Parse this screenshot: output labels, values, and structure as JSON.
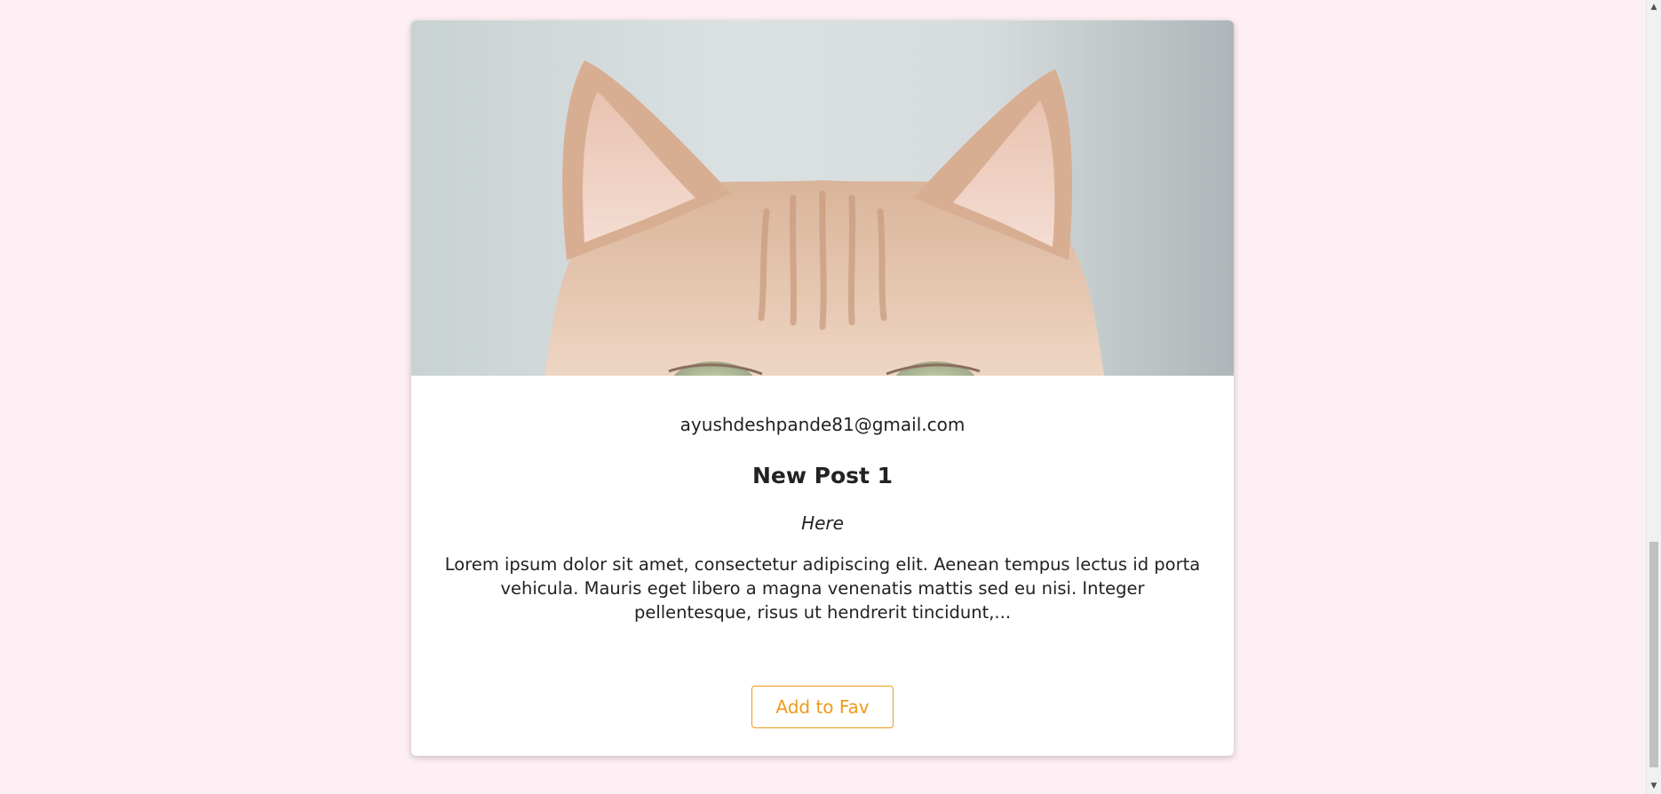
{
  "post": {
    "image_description_icon": "cat-photo",
    "author_email": "ayushdeshpande81@gmail.com",
    "title": "New Post 1",
    "subtitle": "Here",
    "excerpt": "Lorem ipsum dolor sit amet, consectetur adipiscing elit. Aenean tempus lectus id porta vehicula. Mauris eget libero a magna venenatis mattis sed eu nisi. Integer pellentesque, risus ut hendrerit tincidunt,...",
    "fav_button_label": "Add to Fav"
  },
  "scrollbar": {
    "up_arrow": "▲",
    "down_arrow": "▼"
  },
  "colors": {
    "page_background": "#fdeff3",
    "accent": "#ef9a1a",
    "card_background": "#ffffff",
    "text": "#222222"
  }
}
